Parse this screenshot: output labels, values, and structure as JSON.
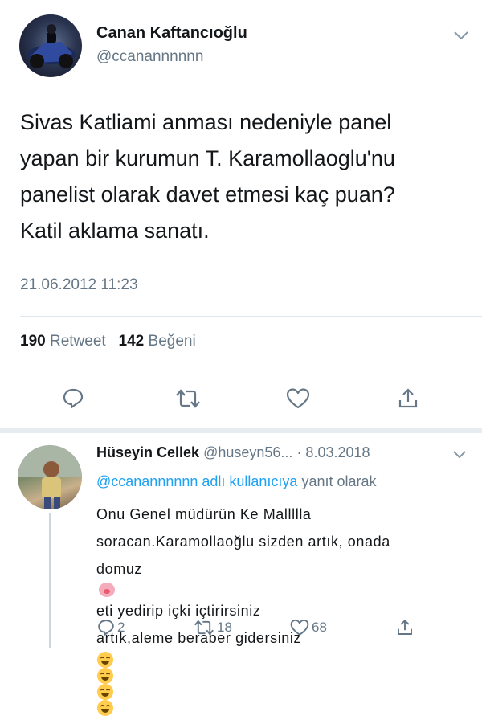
{
  "tweet": {
    "author_name": "Canan Kaftancıoğlu",
    "author_handle": "@ccanannnnnn",
    "text_lines": [
      "Sivas Katliami anması nedeniyle panel",
      "yapan bir kurumun T. Karamollaoglu'nu",
      "panelist olarak davet etmesi kaç puan?",
      "Katil aklama sanatı."
    ],
    "timestamp": "21.06.2012 11:23",
    "retweet_count": "190",
    "retweet_label": "Retweet",
    "like_count": "142",
    "like_label": "Beğeni"
  },
  "icons": {
    "reply": "reply-bubble-icon",
    "retweet": "retweet-icon",
    "like": "heart-icon",
    "share": "share-icon",
    "menu": "chevron-down-icon"
  },
  "reply": {
    "author_name": "Hüseyin Cellek",
    "author_handle": "@huseyn56...",
    "date": "· 8.03.2018",
    "reply_to_mention": "@ccanannnnnn adlı kullanıcıya",
    "reply_to_suffix": " yanıt olarak",
    "line1": "Onu Genel müdürün Ke Mallllla",
    "line2": "soracan.Karamollaoğlu sizden artık, onada",
    "line3_a": "domuz",
    "line3_b": "eti yedirip içki içtirirsiniz",
    "line4": "artık,aleme beraber gidersiniz",
    "reply_count": "2",
    "retweet_count": "18",
    "like_count": "68"
  },
  "colors": {
    "text": "#14171a",
    "secondary": "#657786",
    "link": "#1da1f2",
    "divider": "#e1e8ed"
  }
}
